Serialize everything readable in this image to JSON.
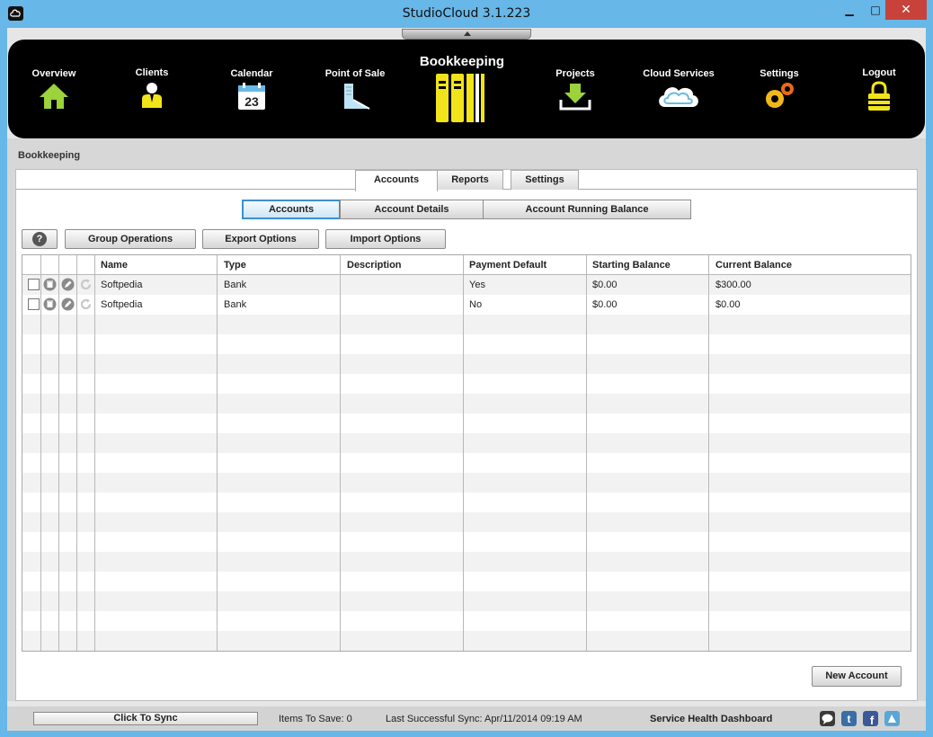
{
  "window": {
    "title": "StudioCloud 3.1.223",
    "min_glyph": "▁",
    "max_glyph": "□",
    "close_glyph": "✕"
  },
  "nav": {
    "items": [
      {
        "label": "Overview",
        "icon": "house-icon"
      },
      {
        "label": "Clients",
        "icon": "person-icon"
      },
      {
        "label": "Calendar",
        "icon": "calendar-icon",
        "calendar_day": "23"
      },
      {
        "label": "Point of Sale",
        "icon": "receipt-icon"
      },
      {
        "label": "Bookkeeping",
        "icon": "ledger-books-icon",
        "active": true
      },
      {
        "label": "Projects",
        "icon": "download-tray-icon"
      },
      {
        "label": "Cloud Services",
        "icon": "cloud-icon"
      },
      {
        "label": "Settings",
        "icon": "gears-icon"
      },
      {
        "label": "Logout",
        "icon": "padlock-icon"
      }
    ]
  },
  "section_title": "Bookkeeping",
  "tabs": [
    {
      "label": "Accounts",
      "active": true
    },
    {
      "label": "Reports"
    },
    {
      "label": "Settings"
    }
  ],
  "subtabs": [
    {
      "label": "Accounts",
      "active": true
    },
    {
      "label": "Account Details"
    },
    {
      "label": "Account Running Balance"
    }
  ],
  "toolbar": {
    "help_label": "?",
    "group_operations": "Group Operations",
    "export_options": "Export Options",
    "import_options": "Import Options"
  },
  "table": {
    "columns": [
      "Name",
      "Type",
      "Description",
      "Payment Default",
      "Starting Balance",
      "Current Balance"
    ],
    "rows": [
      {
        "name": "Softpedia",
        "type": "Bank",
        "description": "",
        "payment_default": "Yes",
        "starting_balance": "$0.00",
        "current_balance": "$300.00"
      },
      {
        "name": "Softpedia",
        "type": "Bank",
        "description": "",
        "payment_default": "No",
        "starting_balance": "$0.00",
        "current_balance": "$0.00"
      }
    ]
  },
  "new_account_label": "New Account",
  "status": {
    "sync_label": "Click To Sync",
    "items_to_save": "Items To Save: 0",
    "last_sync": "Last Successful Sync: Apr/11/2014 09:19 AM",
    "health": "Service Health Dashboard"
  },
  "colors": {
    "accent_yellow": "#f2e41a",
    "icon_green": "#9cd23a",
    "active_blue": "#3c8fd0",
    "titlebar_blue": "#67b7e8"
  }
}
